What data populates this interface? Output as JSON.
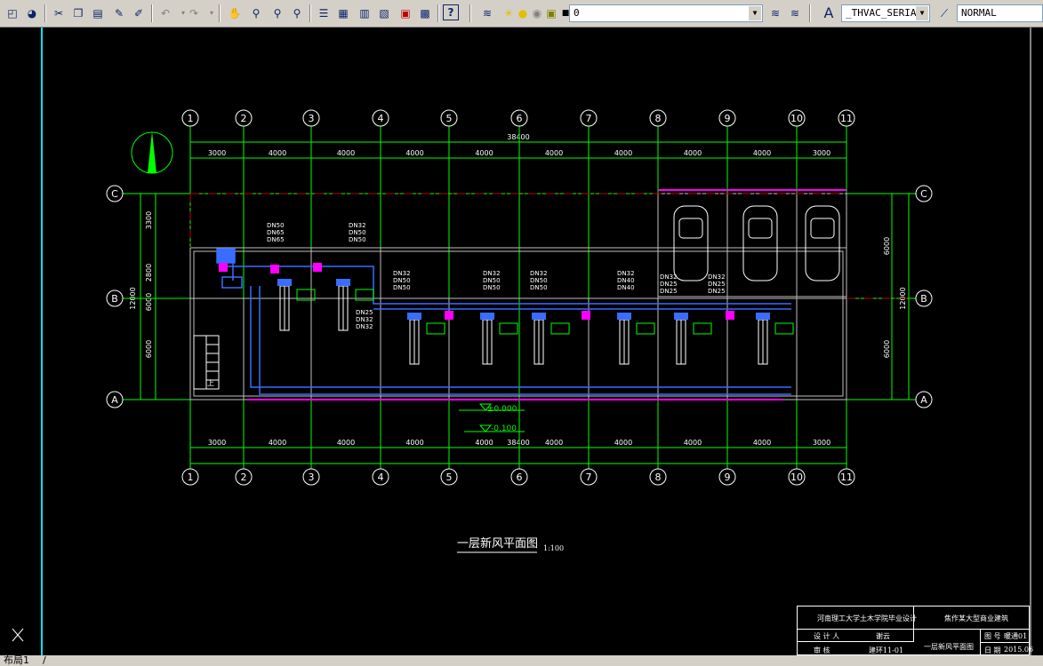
{
  "toolbar": {
    "layer_value": "0",
    "text_style": "_THVAC_SERIAI",
    "dim_style": "NORMAL",
    "icons": [
      "new-icon",
      "open-icon",
      "cut-icon",
      "copy-icon",
      "paste-icon",
      "match-prop-icon",
      "brush-icon",
      "undo-icon",
      "redo-icon",
      "pan-icon",
      "zoom-realtime-icon",
      "zoom-window-icon",
      "zoom-previous-icon",
      "properties-icon",
      "design-center-icon",
      "tool-palette-icon",
      "sheet-set-icon",
      "markup-icon",
      "calculator-icon",
      "help-icon",
      "layer-manager-icon"
    ]
  },
  "drawing": {
    "grid_numbers": [
      "1",
      "2",
      "3",
      "4",
      "5",
      "6",
      "7",
      "8",
      "9",
      "10",
      "11"
    ],
    "grid_letters": [
      "C",
      "B",
      "A"
    ],
    "spans": [
      "3000",
      "4000",
      "4000",
      "4000",
      "4000",
      "4000",
      "4000",
      "4000",
      "4000",
      "3000"
    ],
    "total_length": "38400",
    "left_dims": [
      "3300",
      "2800",
      "6000",
      "6000"
    ],
    "left_total": "12000",
    "right_dims": [
      "6000",
      "6000"
    ],
    "right_total": "12000",
    "pipe_labels": [
      {
        "text": [
          "DN50",
          "DN65",
          "DN65"
        ]
      },
      {
        "text": [
          "DN32",
          "DN50",
          "DN50"
        ]
      },
      {
        "text": [
          "DN32",
          "DN50",
          "DN50"
        ]
      },
      {
        "text": [
          "DN32",
          "DN50",
          "DN50"
        ]
      },
      {
        "text": [
          "DN32",
          "DN50",
          "DN50"
        ]
      },
      {
        "text": [
          "DN32",
          "DN40",
          "DN40"
        ]
      },
      {
        "text": [
          "DN32",
          "DN25",
          "DN25"
        ]
      },
      {
        "text": [
          "DN32",
          "DN25",
          "DN25"
        ]
      },
      {
        "text": [
          "DN25",
          "DN32",
          "DN32"
        ]
      }
    ],
    "level_1": "±0.000",
    "level_2": "-0.100",
    "stair_label": "上",
    "plan_title": "一层新风平面图",
    "plan_scale": "1:100"
  },
  "title_block": {
    "school": "河南理工大学土木学院毕业设计",
    "project": "焦作某大型商业建筑",
    "designer_label": "设 计 人",
    "designer": "谢云",
    "reviewer_label": "审 核",
    "class": "建环11-01",
    "drawing_name": "一层新风平面图",
    "drawing_no_label": "图 号",
    "drawing_no": "暖通01",
    "date_label": "日 期",
    "date": "2015.06"
  },
  "tabs": {
    "layout1": "布局1"
  }
}
